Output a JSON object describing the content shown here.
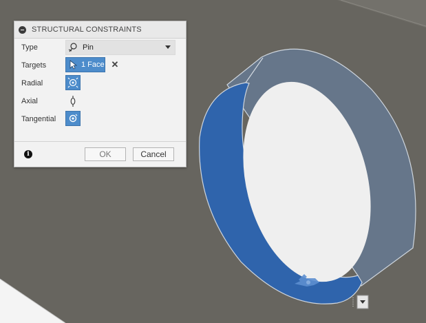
{
  "dialog": {
    "title": "STRUCTURAL CONSTRAINTS",
    "type": {
      "label": "Type",
      "value": "Pin",
      "icon": "pin-icon"
    },
    "targets": {
      "label": "Targets",
      "selection": "1 Face",
      "icon": "cursor-select-icon",
      "clear_icon": "✕"
    },
    "radial": {
      "label": "Radial",
      "icon": "radial-constraint-icon"
    },
    "axial": {
      "label": "Axial",
      "icon": "axial-constraint-icon"
    },
    "tangential": {
      "label": "Tangential",
      "icon": "tangential-constraint-icon"
    },
    "info_icon": "i",
    "ok_label": "OK",
    "cancel_label": "Cancel"
  },
  "colors": {
    "background": "#67655f",
    "face_selected": "#2f64ac",
    "cylinder_side": "#66768a",
    "inner_face": "#efefef",
    "accent": "#4d8ccb"
  }
}
